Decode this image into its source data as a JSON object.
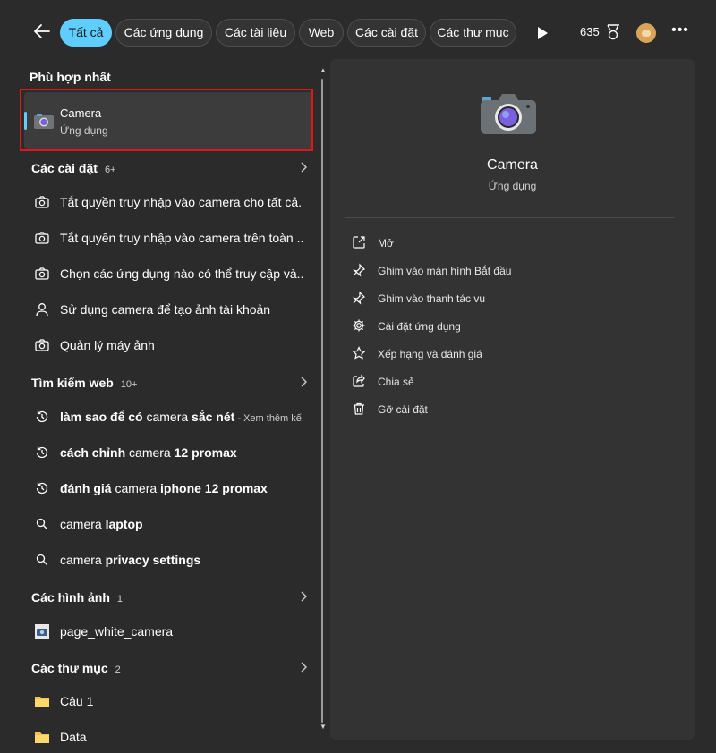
{
  "filters": [
    {
      "label": "Tất cả",
      "active": true
    },
    {
      "label": "Các ứng dụng",
      "active": false
    },
    {
      "label": "Các tài liệu",
      "active": false
    },
    {
      "label": "Web",
      "active": false
    },
    {
      "label": "Các cài đặt",
      "active": false
    },
    {
      "label": "Các thư mục",
      "active": false
    }
  ],
  "points": "635",
  "best_match": {
    "title": "Phù hợp nhất",
    "name": "Camera",
    "type": "Ứng dụng"
  },
  "settings": {
    "title": "Các cài đặt",
    "count": "6+",
    "items": [
      {
        "label": "Tắt quyền truy nhập vào camera cho tất cả..."
      },
      {
        "label": "Tắt quyền truy nhập vào camera trên toàn ..."
      },
      {
        "label": "Chọn các ứng dụng nào có thể truy cập và..."
      },
      {
        "label": "Sử dụng camera để tạo ảnh tài khoản"
      },
      {
        "label": "Quản lý máy ảnh"
      }
    ]
  },
  "web": {
    "title": "Tìm kiếm web",
    "count": "10+",
    "items": [
      {
        "bold_a": "làm sao để có ",
        "normal": "camera",
        "bold_b": " sắc nét",
        "sub": " - Xem thêm kế..."
      },
      {
        "bold_a": "cách chỉnh ",
        "normal": "camera",
        "bold_b": " 12 promax",
        "sub": ""
      },
      {
        "bold_a": "đánh giá ",
        "normal": "camera",
        "bold_b": " iphone 12 promax",
        "sub": ""
      },
      {
        "bold_a": "",
        "normal": "camera",
        "bold_b": " laptop",
        "sub": ""
      },
      {
        "bold_a": "",
        "normal": "camera",
        "bold_b": " privacy settings",
        "sub": ""
      }
    ]
  },
  "images": {
    "title": "Các hình ảnh",
    "count": "1",
    "items": [
      {
        "label": "page_white_camera"
      }
    ]
  },
  "folders": {
    "title": "Các thư mục",
    "count": "2",
    "items": [
      {
        "label": "Câu 1"
      },
      {
        "label": "Data"
      }
    ]
  },
  "panel": {
    "name": "Camera",
    "type": "Ứng dụng",
    "actions": [
      {
        "label": "Mở",
        "icon": "open-icon"
      },
      {
        "label": "Ghim vào màn hình Bắt đầu",
        "icon": "pin-icon"
      },
      {
        "label": "Ghim vào thanh tác vụ",
        "icon": "pin-icon"
      },
      {
        "label": "Cài đặt ứng dụng",
        "icon": "gear-icon"
      },
      {
        "label": "Xếp hạng và đánh giá",
        "icon": "star-icon"
      },
      {
        "label": "Chia sẻ",
        "icon": "share-icon"
      },
      {
        "label": "Gỡ cài đặt",
        "icon": "trash-icon"
      }
    ]
  },
  "colors": {
    "accent": "#60cdff",
    "highlight": "#e0161b",
    "background": "#2b2b2b",
    "panel": "#333333"
  }
}
